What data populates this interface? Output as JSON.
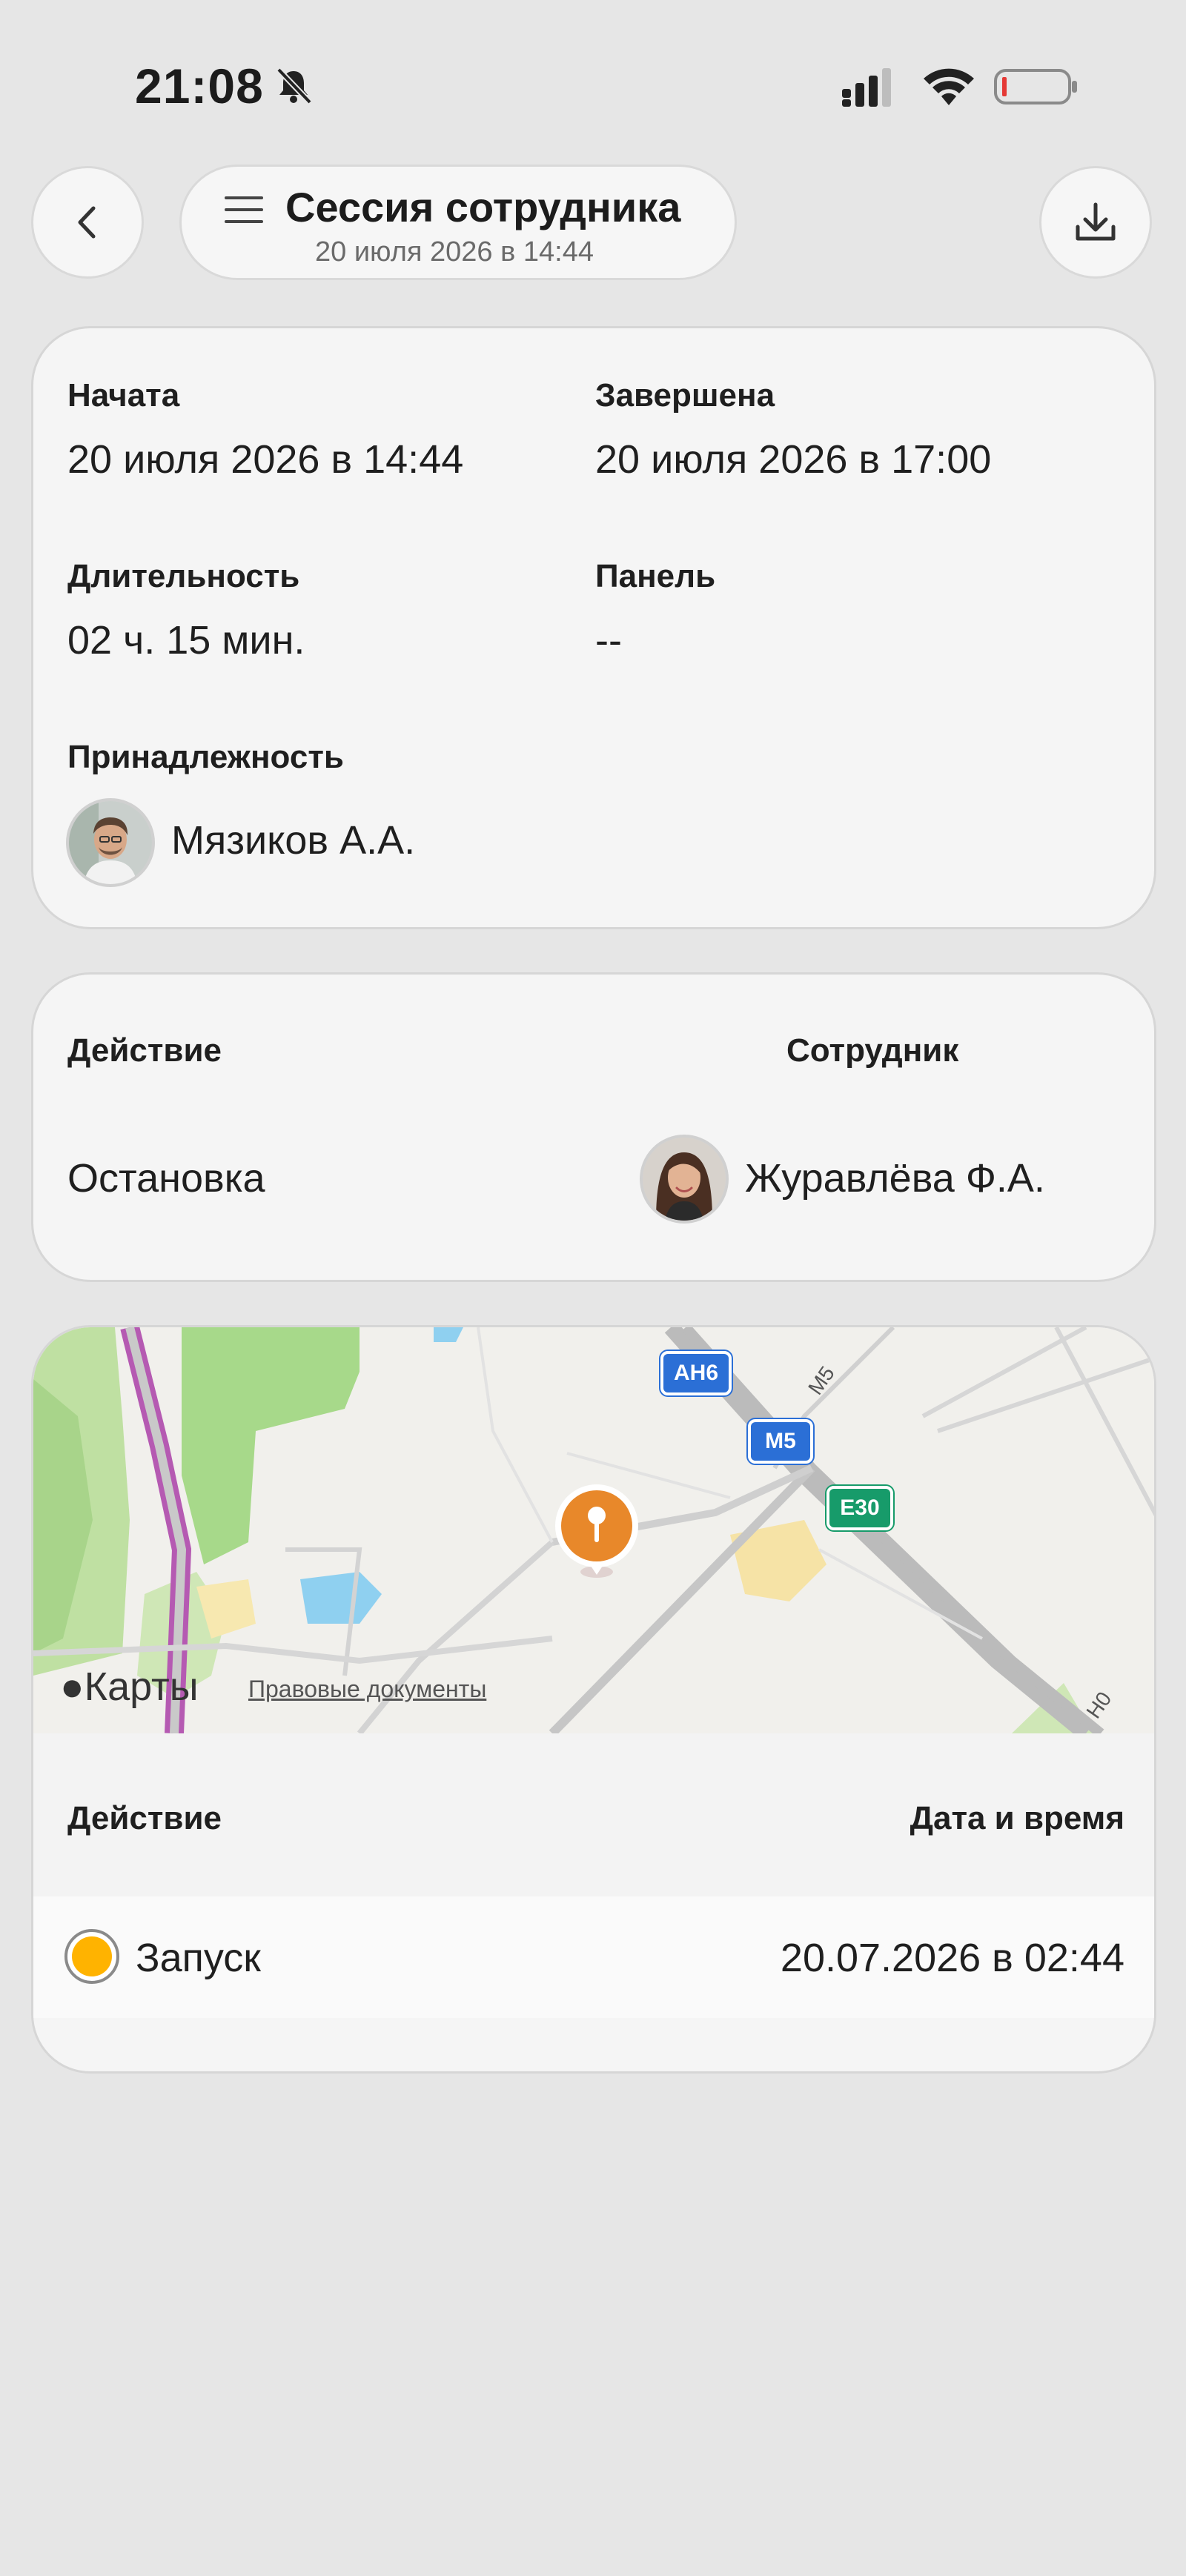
{
  "status_bar": {
    "time": "21:08",
    "icons": [
      "bell-off-icon",
      "signal-icon",
      "wifi-icon",
      "battery-low-icon"
    ]
  },
  "header": {
    "title": "Сессия сотрудника",
    "subtitle": "20 июля 2026 в 14:44"
  },
  "session": {
    "started_label": "Начата",
    "started_value": "20 июля 2026 в 14:44",
    "ended_label": "Завершена",
    "ended_value": "20 июля 2026 в 17:00",
    "duration_label": "Длительность",
    "duration_value": "02 ч. 15 мин.",
    "panel_label": "Панель",
    "panel_value": "--",
    "owner_label": "Принадлежность",
    "owner_name": "Мязиков А.А."
  },
  "action_card": {
    "action_label": "Действие",
    "action_value": "Остановка",
    "employee_label": "Сотрудник",
    "employee_name": "Журавлёва Ф.А."
  },
  "map": {
    "provider": "Карты",
    "legal": "Правовые документы",
    "road_labels": [
      "АН6",
      "М5",
      "Е30",
      "М5",
      "Н0"
    ]
  },
  "events": {
    "col_action": "Действие",
    "col_datetime": "Дата и время",
    "rows": [
      {
        "action": "Запуск",
        "datetime": "20.07.2026 в 02:44",
        "status_color": "#ffb300"
      }
    ]
  },
  "colors": {
    "background": "#e6e6e6",
    "card": "#f5f5f5",
    "pin": "#e8882a",
    "status_dot": "#ffb300"
  }
}
